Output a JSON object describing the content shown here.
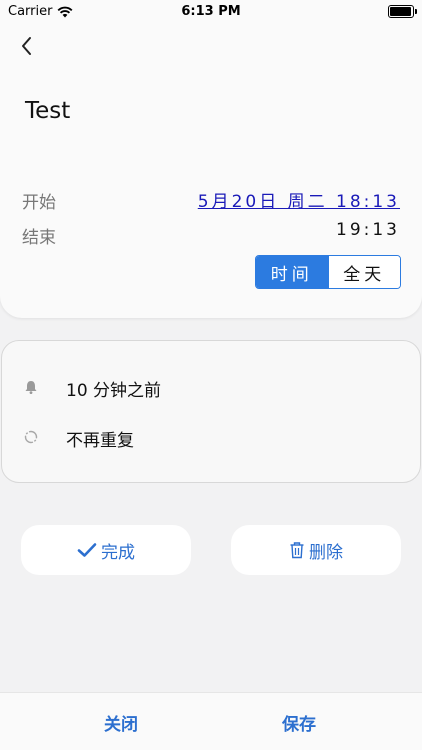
{
  "status_bar": {
    "carrier": "Carrier",
    "time": "6:13 PM",
    "battery_level": 0.95
  },
  "event": {
    "title": "Test",
    "start_label": "开始",
    "start_value": "5月20日 周二 18:13",
    "end_label": "结束",
    "end_value": "19:13"
  },
  "mode_toggle": {
    "time_label": "时间",
    "allday_label": "全天",
    "selected": "time_label"
  },
  "options": {
    "reminder": "10 分钟之前",
    "repeat": "不再重复"
  },
  "actions": {
    "done_label": "完成",
    "delete_label": "删除"
  },
  "bottom_bar": {
    "close_label": "关闭",
    "save_label": "保存"
  },
  "colors": {
    "accent": "#2c7be0",
    "link": "#1a1ab8",
    "action_text": "#2c6fcf"
  }
}
